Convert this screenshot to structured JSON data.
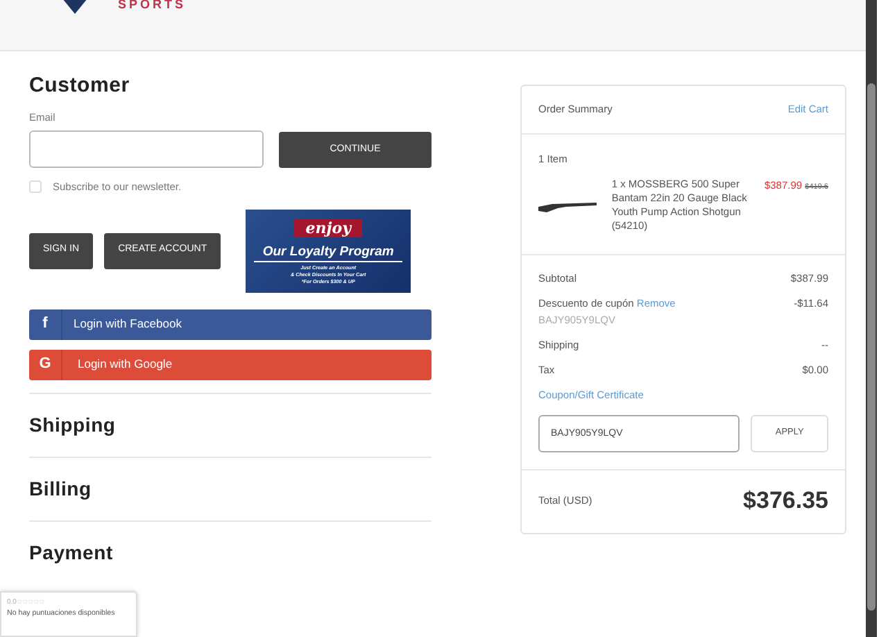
{
  "header": {
    "logo_text": "SPORTS"
  },
  "customer": {
    "title": "Customer",
    "email_label": "Email",
    "continue": "CONTINUE",
    "newsletter": {
      "label": "Subscribe to our newsletter.",
      "checked": false
    },
    "sign_in": "SIGN IN",
    "create_account": "CREATE ACCOUNT"
  },
  "banner": {
    "script": "enjoy",
    "title": "Our Loyalty Program",
    "lines": [
      "Just Create an Account",
      "& Check Discounts In Your Cart",
      "*For Orders $300 & UP"
    ]
  },
  "social": [
    {
      "kind": "facebook",
      "icon": "f",
      "label": "Login with Facebook"
    },
    {
      "kind": "google",
      "icon": "G",
      "label": "Login with Google"
    }
  ],
  "sections": [
    "Shipping",
    "Billing",
    "Payment"
  ],
  "summary": {
    "title": "Order Summary",
    "edit": "Edit Cart",
    "count": "1 Item",
    "item": {
      "name": "1 x MOSSBERG 500 Super Bantam 22in 20 Gauge Black Youth Pump Action Shotgun (54210)",
      "price": "$387.99",
      "old_price": "$419.6"
    },
    "lines": [
      {
        "label": "Subtotal",
        "value": "$387.99"
      },
      {
        "label": "Descuento de cupón",
        "link": "Remove",
        "value": "-$11.64",
        "code": "BAJY905Y9LQV"
      },
      {
        "label": "Shipping",
        "value": "--"
      },
      {
        "label": "Tax",
        "value": "$0.00"
      }
    ],
    "coupon_link": "Coupon/Gift Certificate",
    "coupon_value": "BAJY905Y9LQV",
    "apply": "APPLY",
    "total_label": "Total (USD)",
    "total": "$376.35"
  },
  "reviews": {
    "score": "0.0",
    "stars": 0,
    "text": "No hay puntuaciones disponibles"
  }
}
